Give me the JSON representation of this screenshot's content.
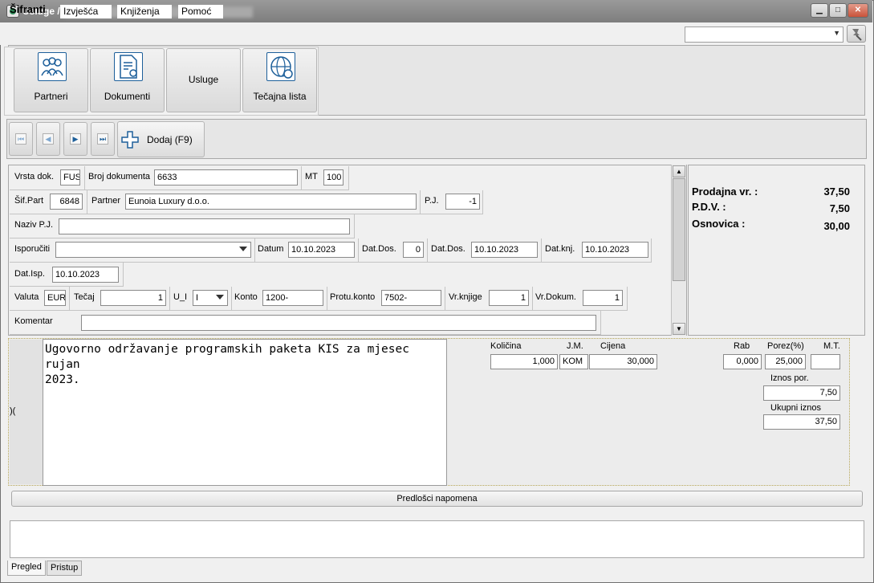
{
  "window": {
    "title": "Usluge /",
    "controls": {
      "minimize": "▁",
      "maximize": "□",
      "close": "✕"
    }
  },
  "menu": [
    {
      "label": "Šifranti",
      "active": true
    },
    {
      "label": "Izvješća"
    },
    {
      "label": "Knjiženja"
    },
    {
      "label": "Pomoć"
    }
  ],
  "search": {
    "value": ""
  },
  "ribbon": {
    "buttons": [
      {
        "label": "Partneri",
        "icon": "people-icon"
      },
      {
        "label": "Dokumenti",
        "icon": "document-gear-icon"
      },
      {
        "label": "Usluge",
        "icon": ""
      },
      {
        "label": "Tečajna lista",
        "icon": "globe-currency-icon"
      }
    ]
  },
  "nav": {
    "first": "⏮",
    "prev": "◀",
    "next": "▶",
    "last": "⏭",
    "add_label": "Dodaj (F9)"
  },
  "form": {
    "vrsta_dok_label": "Vrsta dok.",
    "vrsta_dok": "FUS",
    "broj_dok_label": "Broj dokumenta",
    "broj_dok": "6633",
    "mt_label": "MT",
    "mt": "100",
    "sif_part_label": "Šif.Part",
    "sif_part": "6848",
    "partner_label": "Partner",
    "partner": "Eunoia Luxury d.o.o.",
    "pj_label": "P.J.",
    "pj": "-1",
    "naziv_pj_label": "Naziv P.J.",
    "naziv_pj": "",
    "isporuciti_label": "Isporučiti",
    "isporuciti": "",
    "datum_label": "Datum",
    "datum": "10.10.2023",
    "dat_dos1_label": "Dat.Dos.",
    "dat_dos1": "0",
    "dat_dos2_label": "Dat.Dos.",
    "dat_dos2": "10.10.2023",
    "dat_knj_label": "Dat.knj.",
    "dat_knj": "10.10.2023",
    "dat_isp_label": "Dat.Isp.",
    "dat_isp": "10.10.2023",
    "valuta_label": "Valuta",
    "valuta": "EUR",
    "tecaj_label": "Tečaj",
    "tecaj": "1",
    "u_i_label": "U_I",
    "u_i": "I",
    "konto_label": "Konto",
    "konto": "1200-",
    "protu_konto_label": "Protu.konto",
    "protu_konto": "7502-",
    "vr_knjige_label": "Vr.knjige",
    "vr_knjige": "1",
    "vr_dokum_label": "Vr.Dokum.",
    "vr_dokum": "1",
    "komentar_label": "Komentar",
    "komentar": ""
  },
  "totals": {
    "prodajna_label": "Prodajna vr. :",
    "prodajna": "37,50",
    "pdv_label": "P.D.V. :",
    "pdv": "7,50",
    "osnovica_label": "Osnovica :",
    "osnovica": "30,00"
  },
  "item": {
    "gutter_mark": ")(",
    "description": "Ugovorno održavanje programskih paketa KIS za mjesec\nrujan\n2023.",
    "kolicina_label": "Količina",
    "kolicina": "1,000",
    "jm_label": "J.M.",
    "jm": "KOM",
    "cijena_label": "Cijena",
    "cijena": "30,000",
    "rab_label": "Rab",
    "rab": "0,000",
    "porez_label": "Porez(%)",
    "porez": "25,000",
    "mt_label": "M.T.",
    "mt": "",
    "iznos_por_label": "Iznos por.",
    "iznos_por": "7,50",
    "ukupni_label": "Ukupni iznos",
    "ukupni": "37,50"
  },
  "templates_button": "Predlošci napomena",
  "bottom_tabs": [
    {
      "label": "Pregled",
      "active": true
    },
    {
      "label": "Pristup"
    }
  ],
  "colors": {
    "icon_blue": "#1d5f9a",
    "titlebar": "#8a8a8a"
  }
}
